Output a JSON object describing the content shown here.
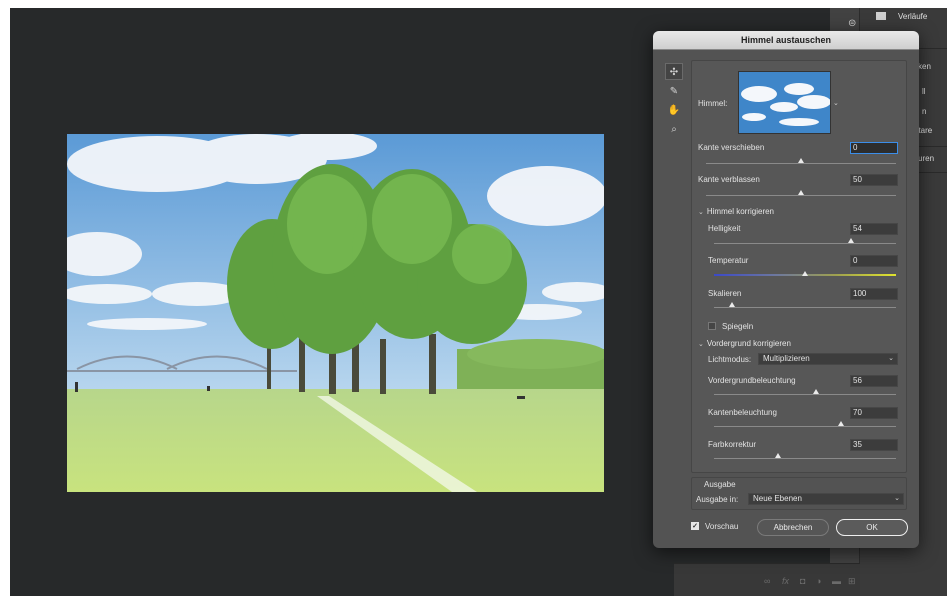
{
  "dialog": {
    "title": "Himmel austauschen"
  },
  "tools": [
    {
      "icon": "move-icon",
      "glyph": "✣"
    },
    {
      "icon": "brush-icon",
      "glyph": "✎"
    },
    {
      "icon": "hand-icon",
      "glyph": "✋"
    },
    {
      "icon": "zoom-icon",
      "glyph": "⌕"
    }
  ],
  "sky": {
    "label": "Himmel:"
  },
  "kante_verschieben": {
    "label": "Kante verschieben",
    "value": "0",
    "level": 0.5
  },
  "kante_verblassen": {
    "label": "Kante verblassen",
    "value": "50",
    "level": 0.5
  },
  "himmel_korrigieren": {
    "title": "Himmel korrigieren",
    "helligkeit": {
      "label": "Helligkeit",
      "value": "54",
      "level": 0.75
    },
    "temperatur": {
      "label": "Temperatur",
      "value": "0",
      "level": 0.5
    },
    "skalieren": {
      "label": "Skalieren",
      "value": "100",
      "level": 0.1
    },
    "spiegeln": {
      "label": "Spiegeln",
      "checked": false
    }
  },
  "vordergrund_korrigieren": {
    "title": "Vordergrund korrigieren",
    "lichtmodus": {
      "label": "Lichtmodus:",
      "value": "Multiplizieren"
    },
    "vordergrundbeleuchtung": {
      "label": "Vordergrundbeleuchtung",
      "value": "56",
      "level": 0.56
    },
    "kantenbeleuchtung": {
      "label": "Kantenbeleuchtung",
      "value": "70",
      "level": 0.7
    },
    "farbkorrektur": {
      "label": "Farbkorrektur",
      "value": "35",
      "level": 0.35
    }
  },
  "ausgabe": {
    "title": "Ausgabe",
    "label": "Ausgabe in:",
    "value": "Neue Ebenen"
  },
  "vorschau": {
    "label": "Vorschau",
    "checked": true
  },
  "buttons": {
    "cancel": "Abbrechen",
    "ok": "OK"
  },
  "right_panel": {
    "items": [
      "Verläufe",
      "cken",
      "ll",
      "n",
      "ntare",
      "ituren"
    ]
  },
  "layers_footer_icons": [
    "link-icon",
    "fx-icon",
    "mask-icon",
    "adjustment-icon",
    "folder-icon",
    "new-layer-icon",
    "trash-icon"
  ],
  "colors": {
    "accent": "#3b8eea",
    "dialog_bg": "#535353",
    "workspace_bg": "#27292a"
  }
}
